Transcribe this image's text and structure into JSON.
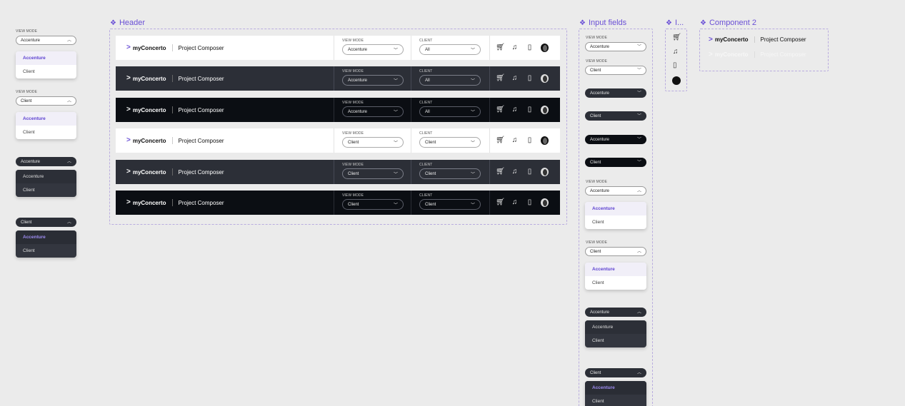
{
  "frames": {
    "header": "Header",
    "inputs": "Input fields",
    "icons": "I...",
    "component2": "Component 2"
  },
  "labels": {
    "view_mode": "VIEW MODE",
    "client": "CLIENT"
  },
  "options": {
    "accenture": "Accenture",
    "client": "Client",
    "all": "All"
  },
  "brand": {
    "logo_text": "myConcerto",
    "project": "Project Composer",
    "accent": "#6a4fd6"
  },
  "header_rows": [
    {
      "theme": "white",
      "view_mode": "Accenture",
      "client": "All"
    },
    {
      "theme": "dark",
      "view_mode": "Accenture",
      "client": "All"
    },
    {
      "theme": "black",
      "view_mode": "Accenture",
      "client": "All"
    },
    {
      "theme": "white",
      "view_mode": "Client",
      "client": "Client"
    },
    {
      "theme": "dark",
      "view_mode": "Client",
      "client": "Client"
    },
    {
      "theme": "black",
      "view_mode": "Client",
      "client": "Client"
    }
  ],
  "icon_names": [
    "cart-icon",
    "bell-icon",
    "bookmark-icon",
    "avatar"
  ]
}
